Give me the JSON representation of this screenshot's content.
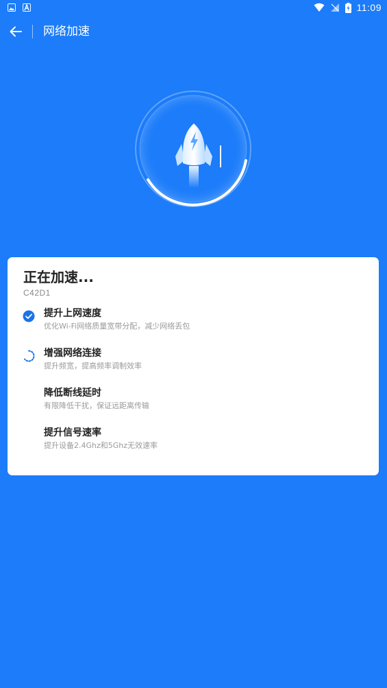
{
  "status_bar": {
    "time": "11:09"
  },
  "header": {
    "title": "网络加速"
  },
  "card": {
    "title": "正在加速...",
    "subtitle": "C42D1",
    "steps": [
      {
        "title": "提升上网速度",
        "desc": "优化Wi-Fi网络质量宽带分配，减少网络丢包",
        "state": "done"
      },
      {
        "title": "增强网络连接",
        "desc": "提升频宽，提高频率调制效率",
        "state": "loading"
      },
      {
        "title": "降低断线延时",
        "desc": "有限降低干扰，保证远距离传输",
        "state": "pending"
      },
      {
        "title": "提升信号速率",
        "desc": "提升设备2.4Ghz和5Ghz无效速率",
        "state": "pending"
      }
    ]
  },
  "colors": {
    "background": "#1c7cf9",
    "accent": "#1a73e8",
    "card": "#ffffff"
  }
}
